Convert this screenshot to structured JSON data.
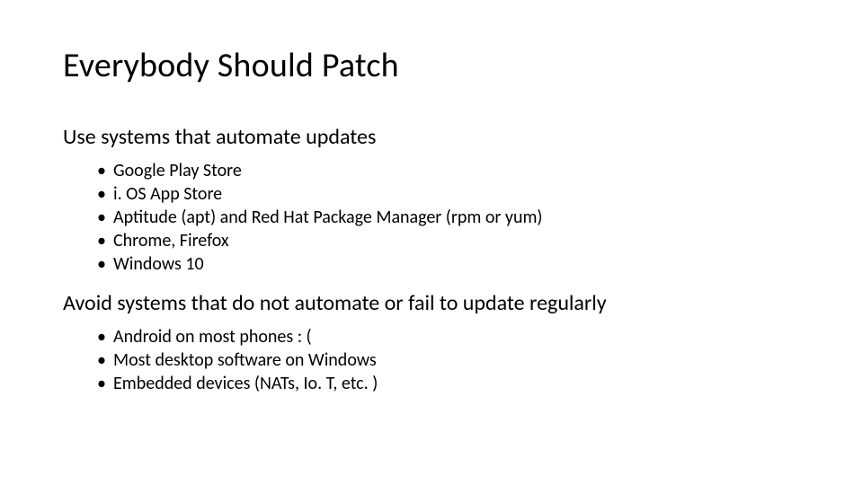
{
  "title": "Everybody Should Patch",
  "section1": {
    "heading": "Use systems that automate updates",
    "items": [
      "Google Play Store",
      "i. OS App Store",
      "Aptitude (apt) and Red Hat Package Manager (rpm or yum)",
      "Chrome, Firefox",
      "Windows 10"
    ]
  },
  "section2": {
    "heading": "Avoid systems that do not automate or fail to update regularly",
    "items": [
      "Android on most phones : (",
      "Most desktop software on Windows",
      "Embedded devices (NATs, Io. T, etc. )"
    ]
  }
}
